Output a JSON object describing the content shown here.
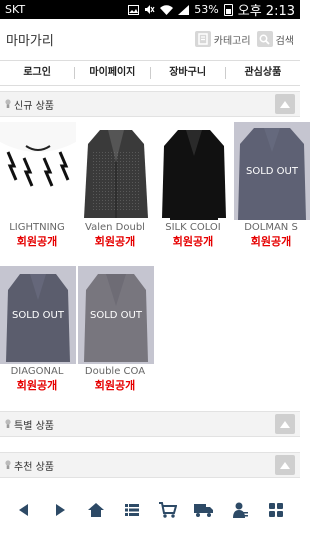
{
  "status_bar": {
    "carrier": "SKT",
    "battery": "53%",
    "time": "오후 2:13",
    "icons": [
      "image-icon",
      "mute-icon",
      "wifi-icon",
      "signal-icon",
      "battery-icon"
    ]
  },
  "header": {
    "logo": "마마가리",
    "category_label": "카테고리",
    "search_label": "검색"
  },
  "nav": {
    "items": [
      "로그인",
      "마이페이지",
      "장바구니",
      "관심상품"
    ]
  },
  "sections": {
    "new": "신규 상품",
    "special": "특별 상품",
    "recommended": "추천 상품"
  },
  "products": [
    {
      "name": "LIGHTNING",
      "price": "회원공개",
      "sold_out": false,
      "sold_out_label": ""
    },
    {
      "name": "Valen Doubl",
      "price": "회원공개",
      "sold_out": false,
      "sold_out_label": ""
    },
    {
      "name": "SILK COLOI",
      "price": "회원공개",
      "sold_out": false,
      "sold_out_label": ""
    },
    {
      "name": "DOLMAN S",
      "price": "회원공개",
      "sold_out": true,
      "sold_out_label": "SOLD OUT"
    },
    {
      "name": "DIAGONAL",
      "price": "회원공개",
      "sold_out": true,
      "sold_out_label": "SOLD OUT"
    },
    {
      "name": "Double COA",
      "price": "회원공개",
      "sold_out": true,
      "sold_out_label": "SOLD OUT"
    }
  ],
  "bottom_bar": {
    "icons": [
      "back-icon",
      "forward-icon",
      "home-icon",
      "list-icon",
      "cart-icon",
      "delivery-icon",
      "user-icon",
      "grid-icon"
    ]
  }
}
